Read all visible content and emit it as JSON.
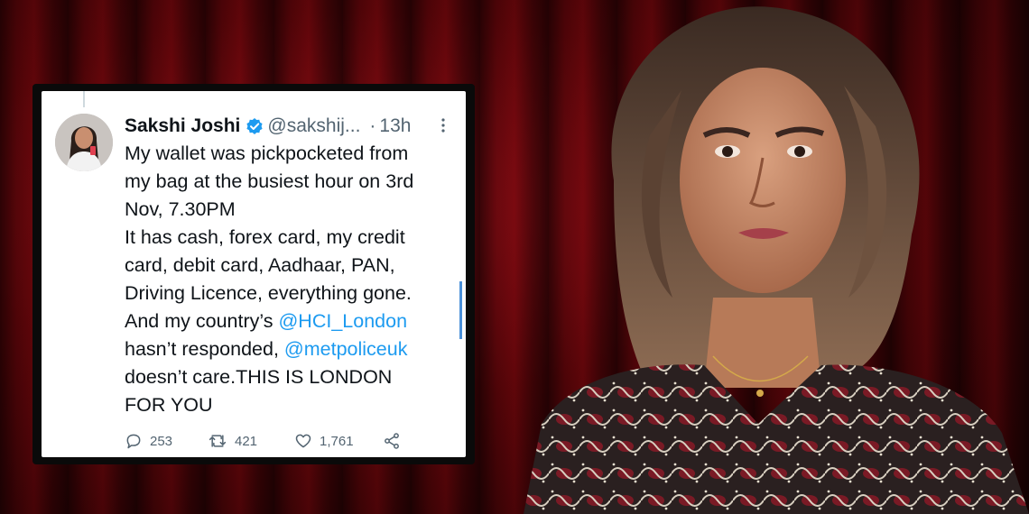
{
  "tweet": {
    "display_name": "Sakshi Joshi",
    "handle": "@sakshij...",
    "separator": "·",
    "time": "13h",
    "lines": {
      "l1": "My wallet was pickpocketed from",
      "l2": "my bag at the busiest hour on 3rd",
      "l3": "Nov, 7.30PM",
      "l4": "It has cash, forex card, my credit",
      "l5": "card, debit card, Aadhaar, PAN,",
      "l6": "Driving Licence, everything gone.",
      "l7a": "And my country’s ",
      "l7b": "@HCI_London",
      "l8a": "hasn’t responded, ",
      "l8b": "@metpoliceuk",
      "l9": "doesn’t care.THIS IS LONDON",
      "l10": "FOR YOU"
    },
    "stats": {
      "replies": "253",
      "retweets": "421",
      "likes": "1,761"
    }
  },
  "colors": {
    "mention": "#1d9bf0",
    "verified": "#1d9bf0",
    "curtain": "#6b070d"
  },
  "icons": [
    "verified-badge-icon",
    "more-icon",
    "reply-icon",
    "retweet-icon",
    "like-icon",
    "share-icon"
  ]
}
